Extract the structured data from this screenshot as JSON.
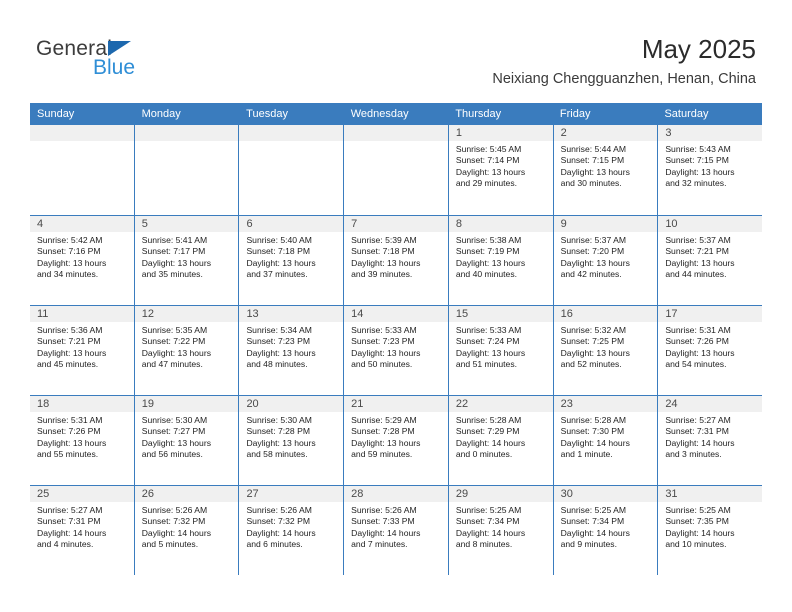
{
  "brand": {
    "word1": "General",
    "word2": "Blue",
    "triangle_color": "#1d68ae",
    "blue_color": "#2f8ed6"
  },
  "header": {
    "title": "May 2025",
    "subtitle": "Neixiang Chengguanzhen, Henan, China"
  },
  "theme": {
    "header_blue": "#3a7cbe",
    "daynum_band": "#f0f0f0",
    "text": "#1f1f1f"
  },
  "weekdays": [
    "Sunday",
    "Monday",
    "Tuesday",
    "Wednesday",
    "Thursday",
    "Friday",
    "Saturday"
  ],
  "weeks": [
    [
      {
        "day": "",
        "sunrise": "",
        "sunset": "",
        "daylight1": "",
        "daylight2": ""
      },
      {
        "day": "",
        "sunrise": "",
        "sunset": "",
        "daylight1": "",
        "daylight2": ""
      },
      {
        "day": "",
        "sunrise": "",
        "sunset": "",
        "daylight1": "",
        "daylight2": ""
      },
      {
        "day": "",
        "sunrise": "",
        "sunset": "",
        "daylight1": "",
        "daylight2": ""
      },
      {
        "day": "1",
        "sunrise": "Sunrise: 5:45 AM",
        "sunset": "Sunset: 7:14 PM",
        "daylight1": "Daylight: 13 hours",
        "daylight2": "and 29 minutes."
      },
      {
        "day": "2",
        "sunrise": "Sunrise: 5:44 AM",
        "sunset": "Sunset: 7:15 PM",
        "daylight1": "Daylight: 13 hours",
        "daylight2": "and 30 minutes."
      },
      {
        "day": "3",
        "sunrise": "Sunrise: 5:43 AM",
        "sunset": "Sunset: 7:15 PM",
        "daylight1": "Daylight: 13 hours",
        "daylight2": "and 32 minutes."
      }
    ],
    [
      {
        "day": "4",
        "sunrise": "Sunrise: 5:42 AM",
        "sunset": "Sunset: 7:16 PM",
        "daylight1": "Daylight: 13 hours",
        "daylight2": "and 34 minutes."
      },
      {
        "day": "5",
        "sunrise": "Sunrise: 5:41 AM",
        "sunset": "Sunset: 7:17 PM",
        "daylight1": "Daylight: 13 hours",
        "daylight2": "and 35 minutes."
      },
      {
        "day": "6",
        "sunrise": "Sunrise: 5:40 AM",
        "sunset": "Sunset: 7:18 PM",
        "daylight1": "Daylight: 13 hours",
        "daylight2": "and 37 minutes."
      },
      {
        "day": "7",
        "sunrise": "Sunrise: 5:39 AM",
        "sunset": "Sunset: 7:18 PM",
        "daylight1": "Daylight: 13 hours",
        "daylight2": "and 39 minutes."
      },
      {
        "day": "8",
        "sunrise": "Sunrise: 5:38 AM",
        "sunset": "Sunset: 7:19 PM",
        "daylight1": "Daylight: 13 hours",
        "daylight2": "and 40 minutes."
      },
      {
        "day": "9",
        "sunrise": "Sunrise: 5:37 AM",
        "sunset": "Sunset: 7:20 PM",
        "daylight1": "Daylight: 13 hours",
        "daylight2": "and 42 minutes."
      },
      {
        "day": "10",
        "sunrise": "Sunrise: 5:37 AM",
        "sunset": "Sunset: 7:21 PM",
        "daylight1": "Daylight: 13 hours",
        "daylight2": "and 44 minutes."
      }
    ],
    [
      {
        "day": "11",
        "sunrise": "Sunrise: 5:36 AM",
        "sunset": "Sunset: 7:21 PM",
        "daylight1": "Daylight: 13 hours",
        "daylight2": "and 45 minutes."
      },
      {
        "day": "12",
        "sunrise": "Sunrise: 5:35 AM",
        "sunset": "Sunset: 7:22 PM",
        "daylight1": "Daylight: 13 hours",
        "daylight2": "and 47 minutes."
      },
      {
        "day": "13",
        "sunrise": "Sunrise: 5:34 AM",
        "sunset": "Sunset: 7:23 PM",
        "daylight1": "Daylight: 13 hours",
        "daylight2": "and 48 minutes."
      },
      {
        "day": "14",
        "sunrise": "Sunrise: 5:33 AM",
        "sunset": "Sunset: 7:23 PM",
        "daylight1": "Daylight: 13 hours",
        "daylight2": "and 50 minutes."
      },
      {
        "day": "15",
        "sunrise": "Sunrise: 5:33 AM",
        "sunset": "Sunset: 7:24 PM",
        "daylight1": "Daylight: 13 hours",
        "daylight2": "and 51 minutes."
      },
      {
        "day": "16",
        "sunrise": "Sunrise: 5:32 AM",
        "sunset": "Sunset: 7:25 PM",
        "daylight1": "Daylight: 13 hours",
        "daylight2": "and 52 minutes."
      },
      {
        "day": "17",
        "sunrise": "Sunrise: 5:31 AM",
        "sunset": "Sunset: 7:26 PM",
        "daylight1": "Daylight: 13 hours",
        "daylight2": "and 54 minutes."
      }
    ],
    [
      {
        "day": "18",
        "sunrise": "Sunrise: 5:31 AM",
        "sunset": "Sunset: 7:26 PM",
        "daylight1": "Daylight: 13 hours",
        "daylight2": "and 55 minutes."
      },
      {
        "day": "19",
        "sunrise": "Sunrise: 5:30 AM",
        "sunset": "Sunset: 7:27 PM",
        "daylight1": "Daylight: 13 hours",
        "daylight2": "and 56 minutes."
      },
      {
        "day": "20",
        "sunrise": "Sunrise: 5:30 AM",
        "sunset": "Sunset: 7:28 PM",
        "daylight1": "Daylight: 13 hours",
        "daylight2": "and 58 minutes."
      },
      {
        "day": "21",
        "sunrise": "Sunrise: 5:29 AM",
        "sunset": "Sunset: 7:28 PM",
        "daylight1": "Daylight: 13 hours",
        "daylight2": "and 59 minutes."
      },
      {
        "day": "22",
        "sunrise": "Sunrise: 5:28 AM",
        "sunset": "Sunset: 7:29 PM",
        "daylight1": "Daylight: 14 hours",
        "daylight2": "and 0 minutes."
      },
      {
        "day": "23",
        "sunrise": "Sunrise: 5:28 AM",
        "sunset": "Sunset: 7:30 PM",
        "daylight1": "Daylight: 14 hours",
        "daylight2": "and 1 minute."
      },
      {
        "day": "24",
        "sunrise": "Sunrise: 5:27 AM",
        "sunset": "Sunset: 7:31 PM",
        "daylight1": "Daylight: 14 hours",
        "daylight2": "and 3 minutes."
      }
    ],
    [
      {
        "day": "25",
        "sunrise": "Sunrise: 5:27 AM",
        "sunset": "Sunset: 7:31 PM",
        "daylight1": "Daylight: 14 hours",
        "daylight2": "and 4 minutes."
      },
      {
        "day": "26",
        "sunrise": "Sunrise: 5:26 AM",
        "sunset": "Sunset: 7:32 PM",
        "daylight1": "Daylight: 14 hours",
        "daylight2": "and 5 minutes."
      },
      {
        "day": "27",
        "sunrise": "Sunrise: 5:26 AM",
        "sunset": "Sunset: 7:32 PM",
        "daylight1": "Daylight: 14 hours",
        "daylight2": "and 6 minutes."
      },
      {
        "day": "28",
        "sunrise": "Sunrise: 5:26 AM",
        "sunset": "Sunset: 7:33 PM",
        "daylight1": "Daylight: 14 hours",
        "daylight2": "and 7 minutes."
      },
      {
        "day": "29",
        "sunrise": "Sunrise: 5:25 AM",
        "sunset": "Sunset: 7:34 PM",
        "daylight1": "Daylight: 14 hours",
        "daylight2": "and 8 minutes."
      },
      {
        "day": "30",
        "sunrise": "Sunrise: 5:25 AM",
        "sunset": "Sunset: 7:34 PM",
        "daylight1": "Daylight: 14 hours",
        "daylight2": "and 9 minutes."
      },
      {
        "day": "31",
        "sunrise": "Sunrise: 5:25 AM",
        "sunset": "Sunset: 7:35 PM",
        "daylight1": "Daylight: 14 hours",
        "daylight2": "and 10 minutes."
      }
    ]
  ]
}
